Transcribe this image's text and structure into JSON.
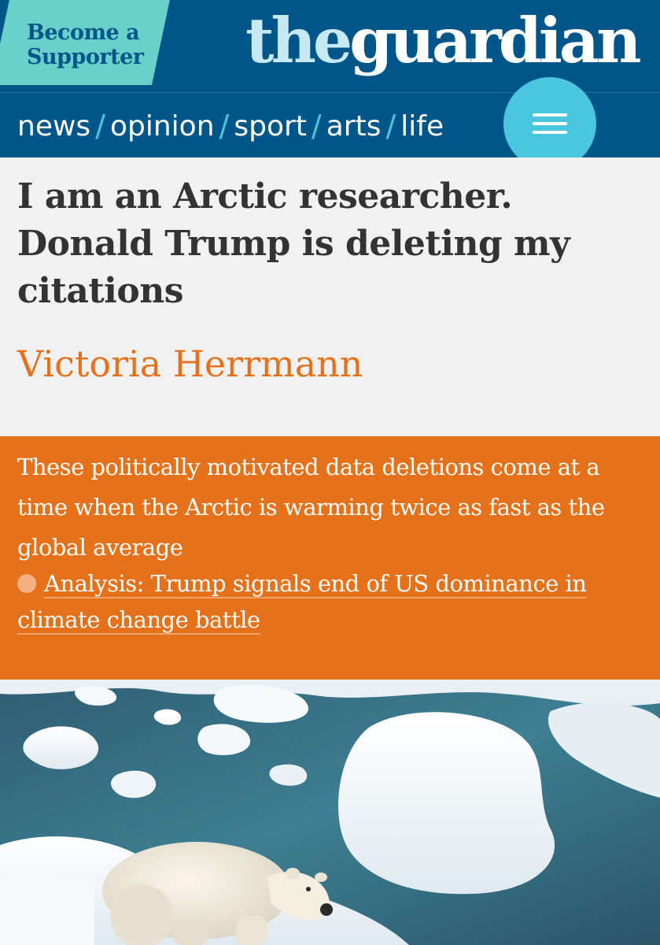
{
  "header": {
    "supporter_label": "Become a Supporter",
    "logo_the": "the",
    "logo_guardian": "guardian",
    "nav": [
      {
        "label": "news"
      },
      {
        "label": "opinion"
      },
      {
        "label": "sport"
      },
      {
        "label": "arts"
      },
      {
        "label": "life"
      }
    ],
    "nav_separator": "/",
    "menu_icon": "hamburger-menu-icon"
  },
  "article": {
    "headline": "I am an Arctic researcher. Donald Trump is deleting my citations",
    "byline": "Victoria Herrmann",
    "standfirst": "These politically motivated data deletions come at a time when the Arctic is warming twice as fast as the global average",
    "related_link": "Analysis: Trump signals end of US dominance in climate change battle",
    "hero_image": "polar-bear-on-sea-ice-photo"
  },
  "colors": {
    "brand_blue": "#005689",
    "supporter_teal": "#69d1ca",
    "nav_accent": "#4bc6df",
    "opinion_orange": "#e6711b",
    "headline_text": "#333333"
  }
}
